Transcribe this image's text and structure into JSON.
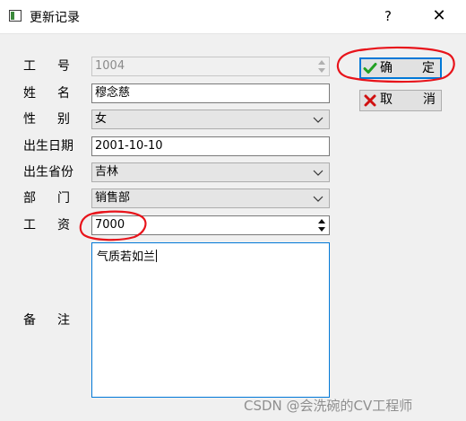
{
  "window": {
    "title": "更新记录",
    "help_label": "?",
    "close_label": "✕"
  },
  "form": {
    "emp_no": {
      "label": "工号",
      "value": "1004"
    },
    "name": {
      "label": "姓名",
      "value": "穆念慈"
    },
    "gender": {
      "label": "性别",
      "value": "女"
    },
    "birth_date": {
      "label": "出生日期",
      "value": "2001-10-10"
    },
    "province": {
      "label": "出生省份",
      "value": "吉林"
    },
    "department": {
      "label": "部门",
      "value": "销售部"
    },
    "salary": {
      "label": "工资",
      "value": "7000"
    },
    "memo": {
      "label": "备注",
      "value": "气质若如兰"
    }
  },
  "buttons": {
    "ok": "确定",
    "cancel": "取消"
  },
  "watermark": "CSDN @会洗碗的CV工程师",
  "colors": {
    "focus": "#0078d7",
    "annotation": "#e8141b",
    "ok_icon": "#22a022",
    "cancel_icon": "#d01010"
  }
}
